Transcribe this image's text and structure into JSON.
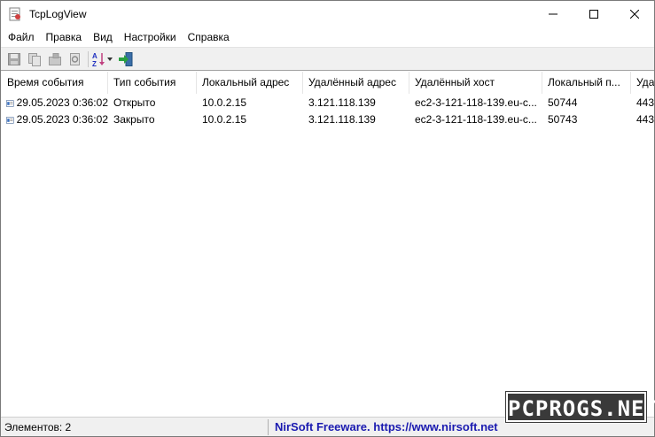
{
  "window": {
    "title": "TcpLogView"
  },
  "menu": {
    "items": [
      "Файл",
      "Правка",
      "Вид",
      "Настройки",
      "Справка"
    ]
  },
  "toolbar": {
    "buttons": [
      "save-icon",
      "copy-icon",
      "properties-icon",
      "find-icon",
      "sort-icon",
      "exit-icon"
    ]
  },
  "table": {
    "columns": [
      "Время события",
      "Тип события",
      "Локальный адрес",
      "Удалённый адрес",
      "Удалённый хост",
      "Локальный п...",
      "Уда"
    ],
    "rows": [
      [
        "29.05.2023 0:36:02",
        "Открыто",
        "10.0.2.15",
        "3.121.118.139",
        "ec2-3-121-118-139.eu-c...",
        "50744",
        "443"
      ],
      [
        "29.05.2023 0:36:02",
        "Закрыто",
        "10.0.2.15",
        "3.121.118.139",
        "ec2-3-121-118-139.eu-c...",
        "50743",
        "443"
      ]
    ]
  },
  "status": {
    "count": "Элементов: 2",
    "link": "NirSoft Freeware. https://www.nirsoft.net"
  },
  "watermark": {
    "text": "PCPROGS.NET"
  }
}
